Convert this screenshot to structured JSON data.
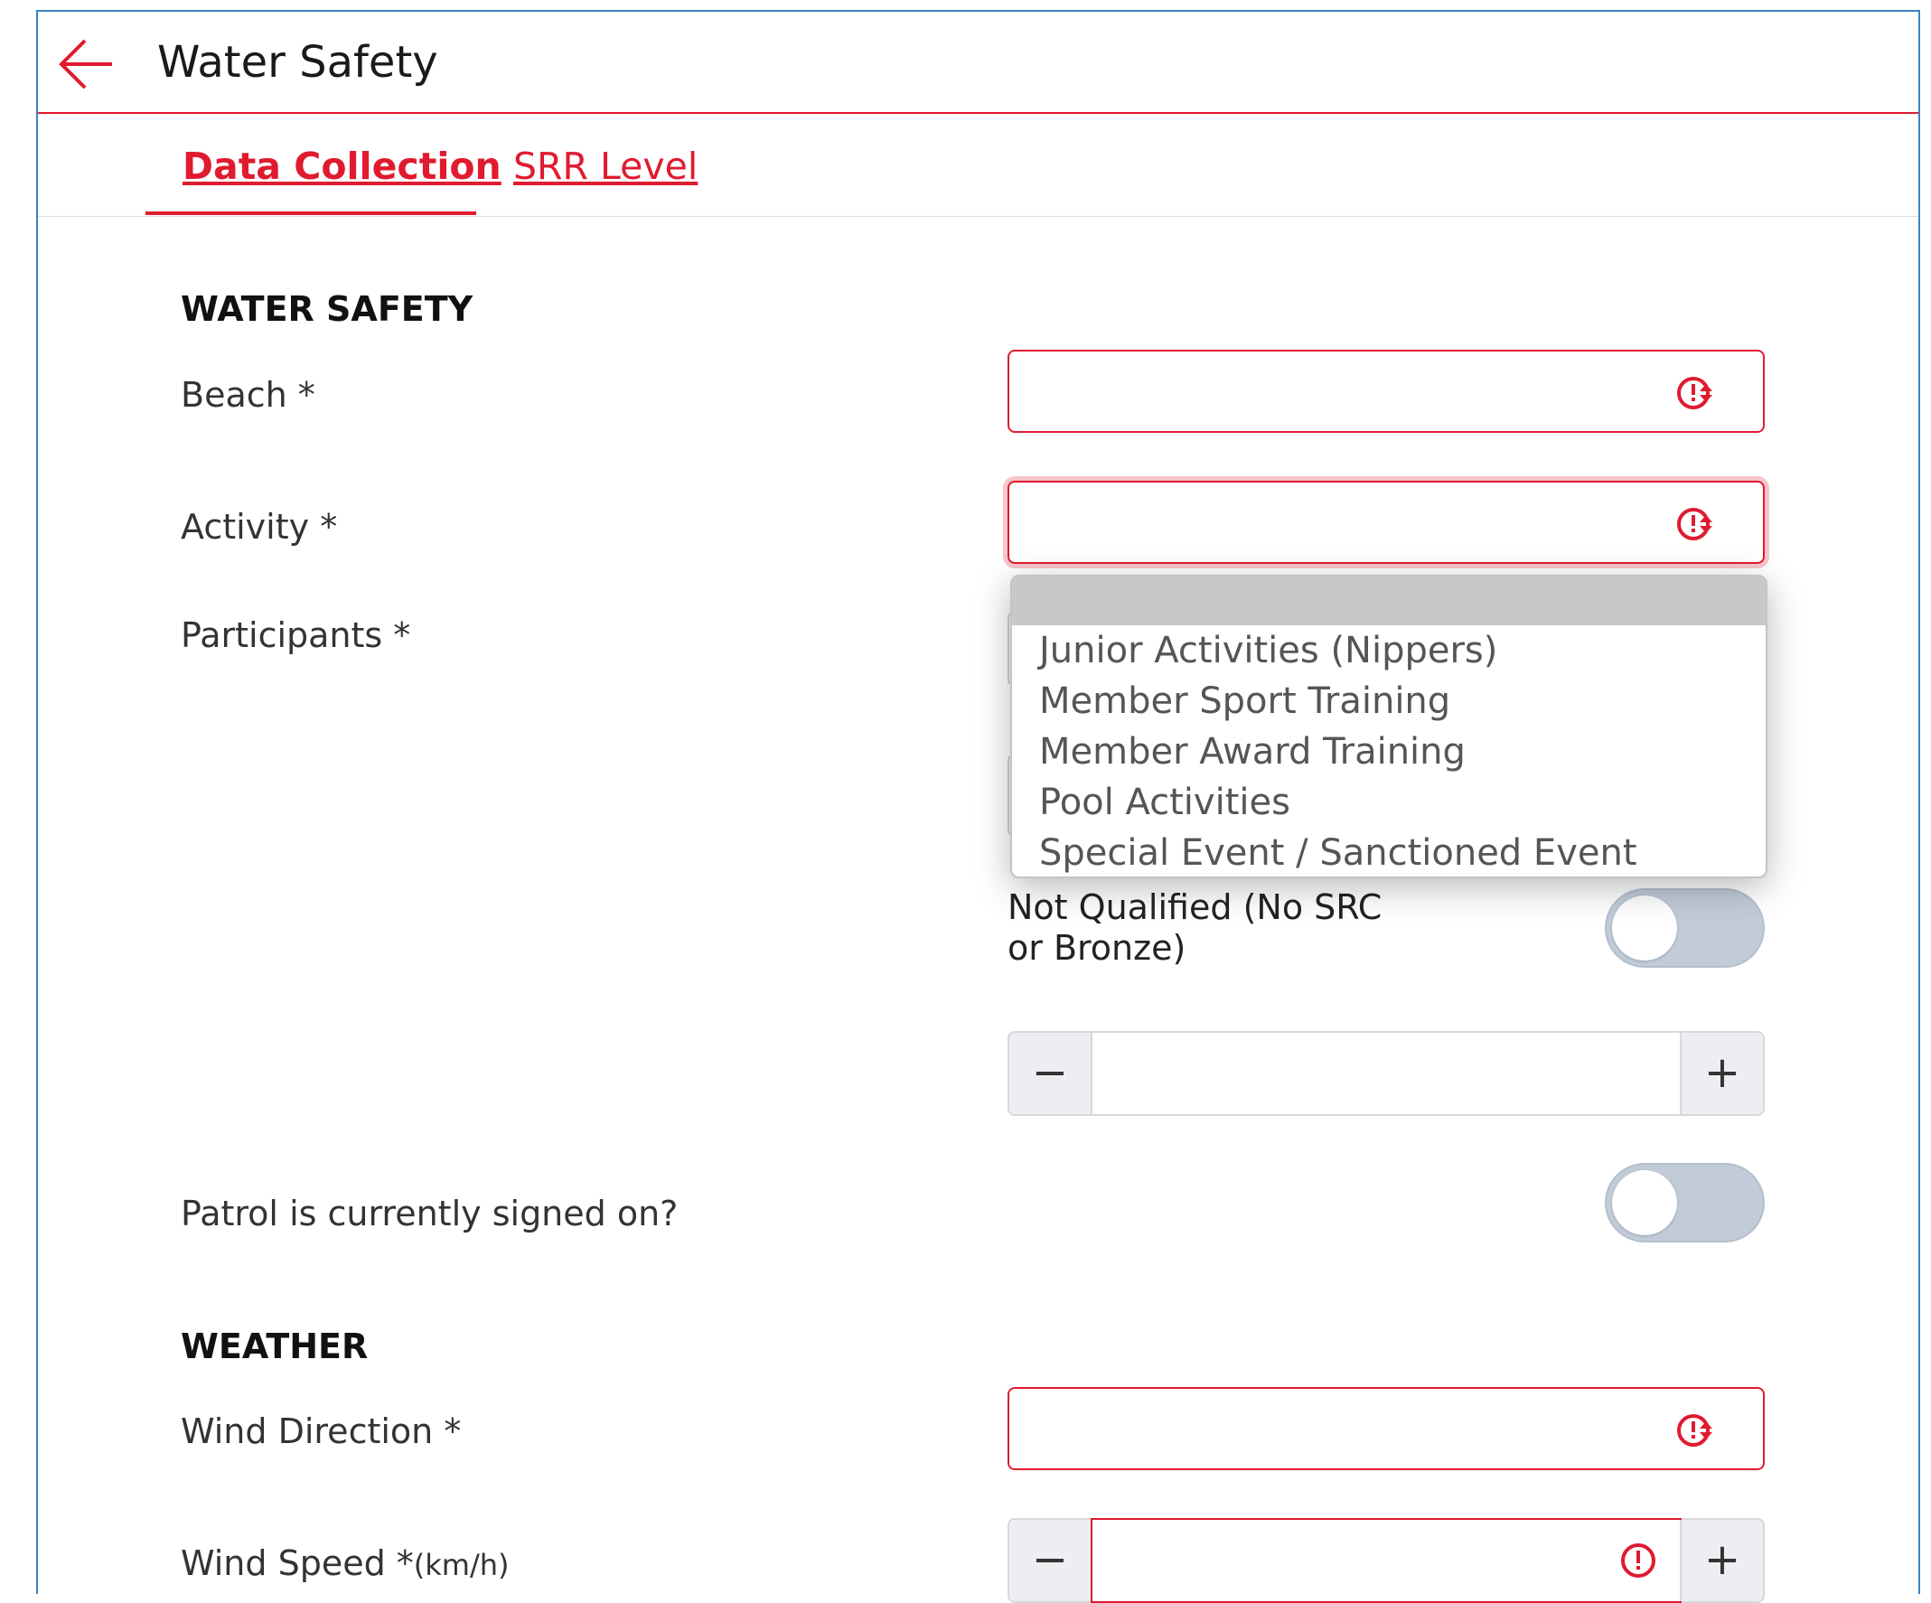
{
  "header": {
    "title": "Water Safety",
    "back_icon": "arrow-left-icon"
  },
  "tabs": [
    {
      "label": "Data Collection",
      "active": true
    },
    {
      "label": "SRR Level",
      "active": false
    }
  ],
  "sections": {
    "water_safety": {
      "heading": "WATER SAFETY",
      "beach_label": "Beach *",
      "activity_label": "Activity *",
      "participants_label": "Participants *",
      "not_qualified_label": "Not Qualified (No SRC or Bronze)",
      "patrol_label": "Patrol is currently signed on?"
    },
    "weather": {
      "heading": "WEATHER",
      "wind_direction_label": "Wind Direction *",
      "wind_speed_label": "Wind Speed *",
      "wind_speed_unit": "(km/h)"
    }
  },
  "activity_dropdown": {
    "options": [
      "Junior Activities (Nippers)",
      "Member Sport Training",
      "Member Award Training",
      "Pool Activities",
      "Special Event / Sanctioned Event"
    ]
  },
  "steppers": {
    "minus": "−",
    "plus": "+"
  },
  "colors": {
    "accent": "#e01b2f",
    "frame": "#3b82c4",
    "toggle_off": "#c2ccd9"
  }
}
